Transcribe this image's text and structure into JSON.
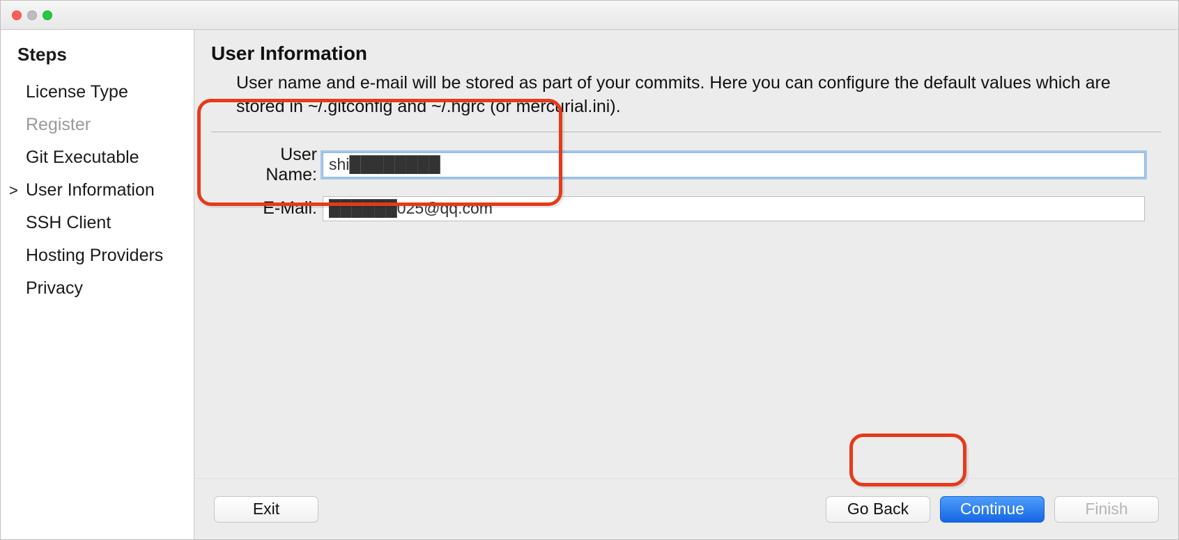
{
  "sidebar": {
    "title": "Steps",
    "items": [
      {
        "label": "License Type",
        "state": "normal"
      },
      {
        "label": "Register",
        "state": "disabled"
      },
      {
        "label": "Git Executable",
        "state": "normal"
      },
      {
        "label": "User Information",
        "state": "current"
      },
      {
        "label": "SSH Client",
        "state": "normal"
      },
      {
        "label": "Hosting Providers",
        "state": "normal"
      },
      {
        "label": "Privacy",
        "state": "normal"
      }
    ]
  },
  "main": {
    "heading": "User Information",
    "description": "User name and e-mail will be stored as part of your commits. Here you can configure the default values which are stored in ~/.gitconfig and ~/.hgrc (or mercurial.ini).",
    "form": {
      "username_label": "User Name:",
      "username_value": "shi████████",
      "email_label": "E-Mail:",
      "email_value": "██████025@qq.com"
    }
  },
  "buttons": {
    "exit": "Exit",
    "go_back": "Go Back",
    "continue": "Continue",
    "finish": "Finish"
  }
}
